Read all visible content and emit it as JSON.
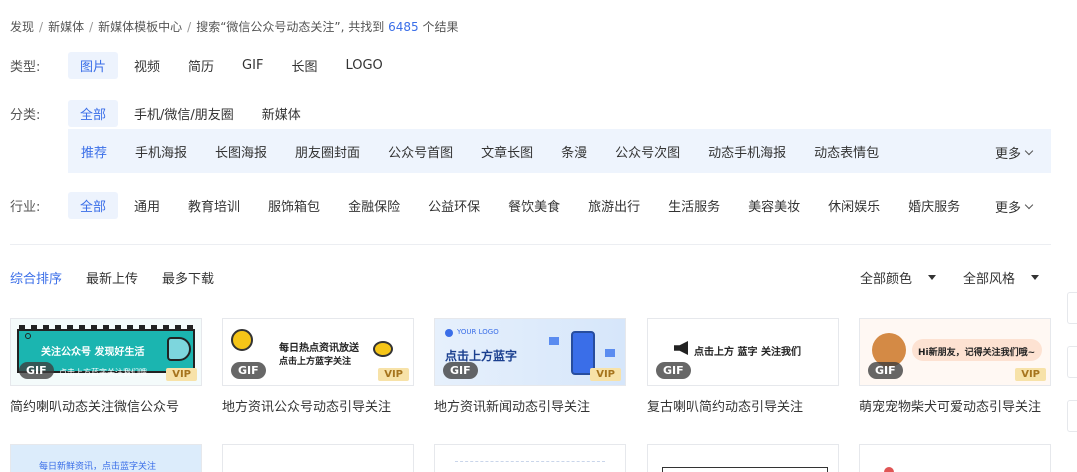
{
  "breadcrumb": {
    "items": [
      "发现",
      "新媒体",
      "新媒体模板中心"
    ],
    "search_prefix": "搜索“微信公众号动态关注”, 共找到",
    "count": "6485",
    "search_suffix": "个结果"
  },
  "filters": {
    "type": {
      "label": "类型:",
      "options": [
        "图片",
        "视频",
        "简历",
        "GIF",
        "长图",
        "LOGO"
      ]
    },
    "category": {
      "label": "分类:",
      "options": [
        "全部",
        "手机/微信/朋友圈",
        "新媒体"
      ],
      "sub": [
        "推荐",
        "手机海报",
        "长图海报",
        "朋友圈封面",
        "公众号首图",
        "文章长图",
        "条漫",
        "公众号次图",
        "动态手机海报",
        "动态表情包"
      ],
      "more": "更多"
    },
    "industry": {
      "label": "行业:",
      "options": [
        "全部",
        "通用",
        "教育培训",
        "服饰箱包",
        "金融保险",
        "公益环保",
        "餐饮美食",
        "旅游出行",
        "生活服务",
        "美容美妆",
        "休闲娱乐",
        "婚庆服务"
      ],
      "more": "更多"
    }
  },
  "sort": {
    "options": [
      "综合排序",
      "最新上传",
      "最多下载"
    ],
    "color": "全部颜色",
    "style": "全部风格"
  },
  "cards": [
    {
      "title": "简约喇叭动态关注微信公众号",
      "badge": "GIF",
      "vip": "VIP",
      "text1": "关注公众号  发现好生活",
      "text2": "点击上方蓝字关注我们哦"
    },
    {
      "title": "地方资讯公众号动态引导关注",
      "badge": "GIF",
      "vip": "VIP",
      "text1": "每日热点资讯放送",
      "text2": "点击上方蓝字关注"
    },
    {
      "title": "地方资讯新闻动态引导关注",
      "badge": "GIF",
      "vip": "VIP",
      "text1": "点击上方蓝字",
      "text2": "YOUR LOGO"
    },
    {
      "title": "复古喇叭简约动态引导关注",
      "badge": "GIF",
      "vip": "",
      "text1": "点击上方 蓝字 关注我们",
      "text2": ""
    },
    {
      "title": "萌宠宠物柴犬可爱动态引导关注",
      "badge": "GIF",
      "vip": "VIP",
      "text1": "Hi新朋友，记得关注我们哦~",
      "text2": ""
    }
  ],
  "row2_text": "每日新鲜资讯，点击蓝字关注",
  "colors": {
    "accent": "#3a6ee8",
    "active_bg": "#edf3fd",
    "subbar_bg": "#eef4fd",
    "vip_bg": "#f7e2a8"
  }
}
